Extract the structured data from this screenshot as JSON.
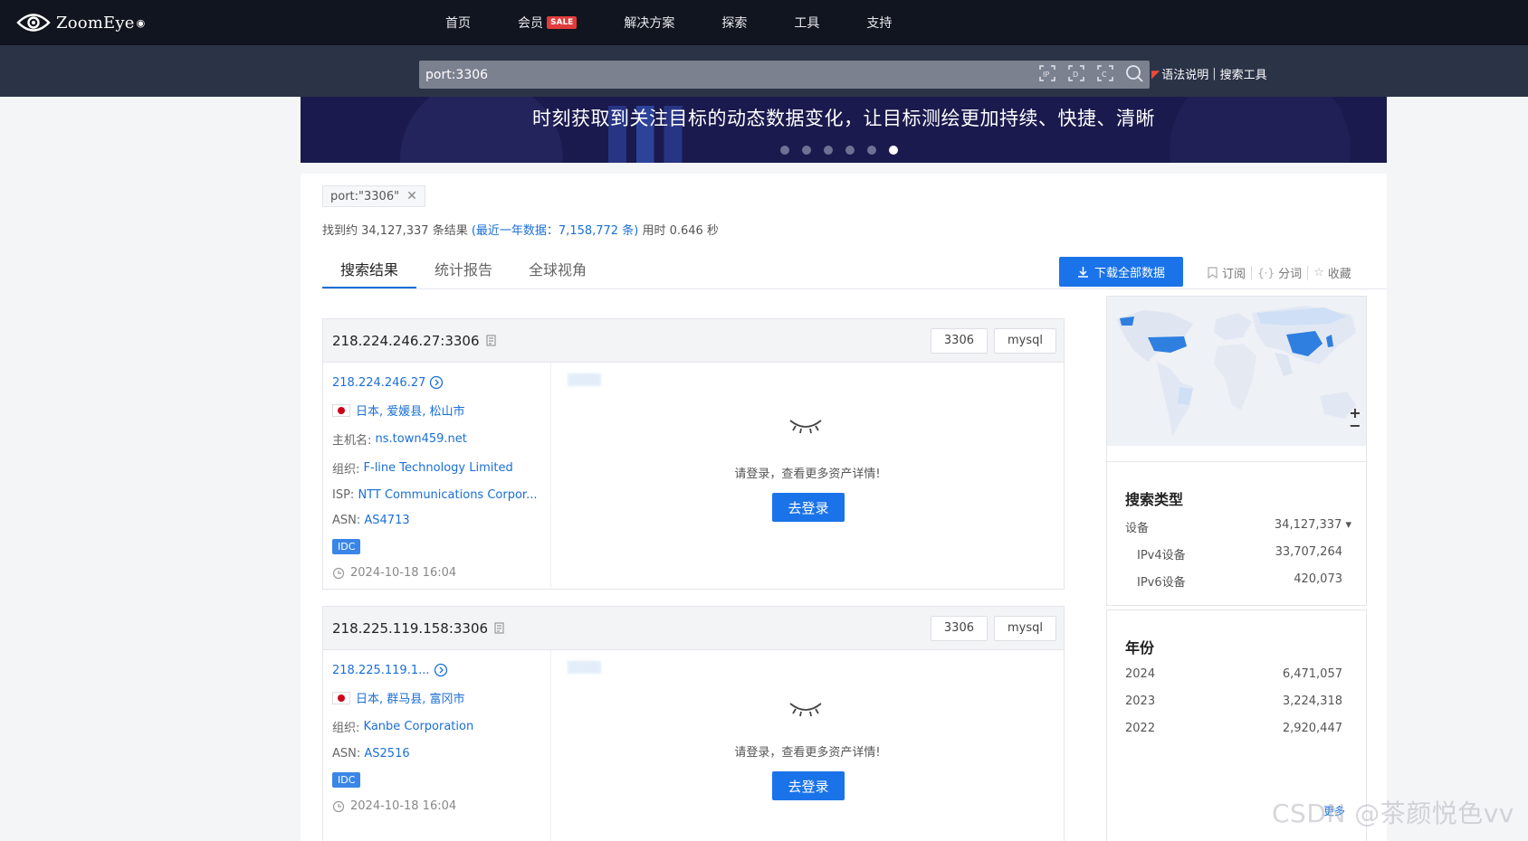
{
  "nav": {
    "logo_text": "ZoomEye",
    "items": [
      {
        "label": "首页"
      },
      {
        "label": "会员",
        "badge": "SALE"
      },
      {
        "label": "解决方案"
      },
      {
        "label": "探索"
      },
      {
        "label": "工具"
      },
      {
        "label": "支持"
      }
    ]
  },
  "search": {
    "value": "port:3306",
    "tools": [
      "ip-search-icon",
      "domain-search-icon",
      "cert-search-icon",
      "search-icon"
    ],
    "link_syntax": "语法说明",
    "link_tools": "搜索工具"
  },
  "banner": {
    "text": "时刻获取到关注目标的动态数据变化，让目标测绘更加持续、快捷、清晰",
    "dots": 6,
    "active_dot": 5
  },
  "filter": {
    "tag": "port:\"3306\""
  },
  "summary": {
    "prefix": "找到约 34,127,337 条结果",
    "recent": "(最近一年数据：7,158,772 条)",
    "time": "用时 0.646 秒"
  },
  "tabs": [
    "搜索结果",
    "统计报告",
    "全球视角"
  ],
  "actions": {
    "download": "下载全部数据",
    "subscribe": "订阅",
    "tokenize": "分词",
    "favorite": "收藏"
  },
  "results": [
    {
      "title": "218.224.246.27:3306",
      "port_tag": "3306",
      "service_tag": "mysql",
      "ip": "218.224.246.27",
      "location": "日本, 爱媛县, 松山市",
      "host_label": "主机名:",
      "host": "ns.town459.net",
      "org_label": "组织:",
      "org": "F-line Technology Limited",
      "isp_label": "ISP:",
      "isp": "NTT Communications Corpor...",
      "asn_label": "ASN:",
      "asn": "AS4713",
      "badge": "IDC",
      "time": "2024-10-18 16:04",
      "login_msg": "请登录，查看更多资产详情!",
      "login_btn": "去登录"
    },
    {
      "title": "218.225.119.158:3306",
      "port_tag": "3306",
      "service_tag": "mysql",
      "ip": "218.225.119.1...",
      "location": "日本, 群马县, 富冈市",
      "org_label": "组织:",
      "org": "Kanbe Corporation",
      "asn_label": "ASN:",
      "asn": "AS2516",
      "badge": "IDC",
      "time": "2024-10-18 16:04",
      "login_msg": "请登录，查看更多资产详情!",
      "login_btn": "去登录"
    }
  ],
  "search_type": {
    "title": "搜索类型",
    "rows": [
      {
        "label": "设备",
        "value": "34,127,337 ▾"
      },
      {
        "label": "IPv4设备",
        "value": "33,707,264"
      },
      {
        "label": "IPv6设备",
        "value": "420,073"
      }
    ]
  },
  "year": {
    "title": "年份",
    "rows": [
      {
        "label": "2024",
        "value": "6,471,057"
      },
      {
        "label": "2023",
        "value": "3,224,318"
      },
      {
        "label": "2022",
        "value": "2,920,447"
      }
    ],
    "more": "更多"
  },
  "watermark": "CSDN @茶颜悦色vv",
  "colors": {
    "nav_bg": "#11151f",
    "search_bg": "#2b3347",
    "accent": "#1a73e8",
    "link": "#1a6fd6"
  }
}
